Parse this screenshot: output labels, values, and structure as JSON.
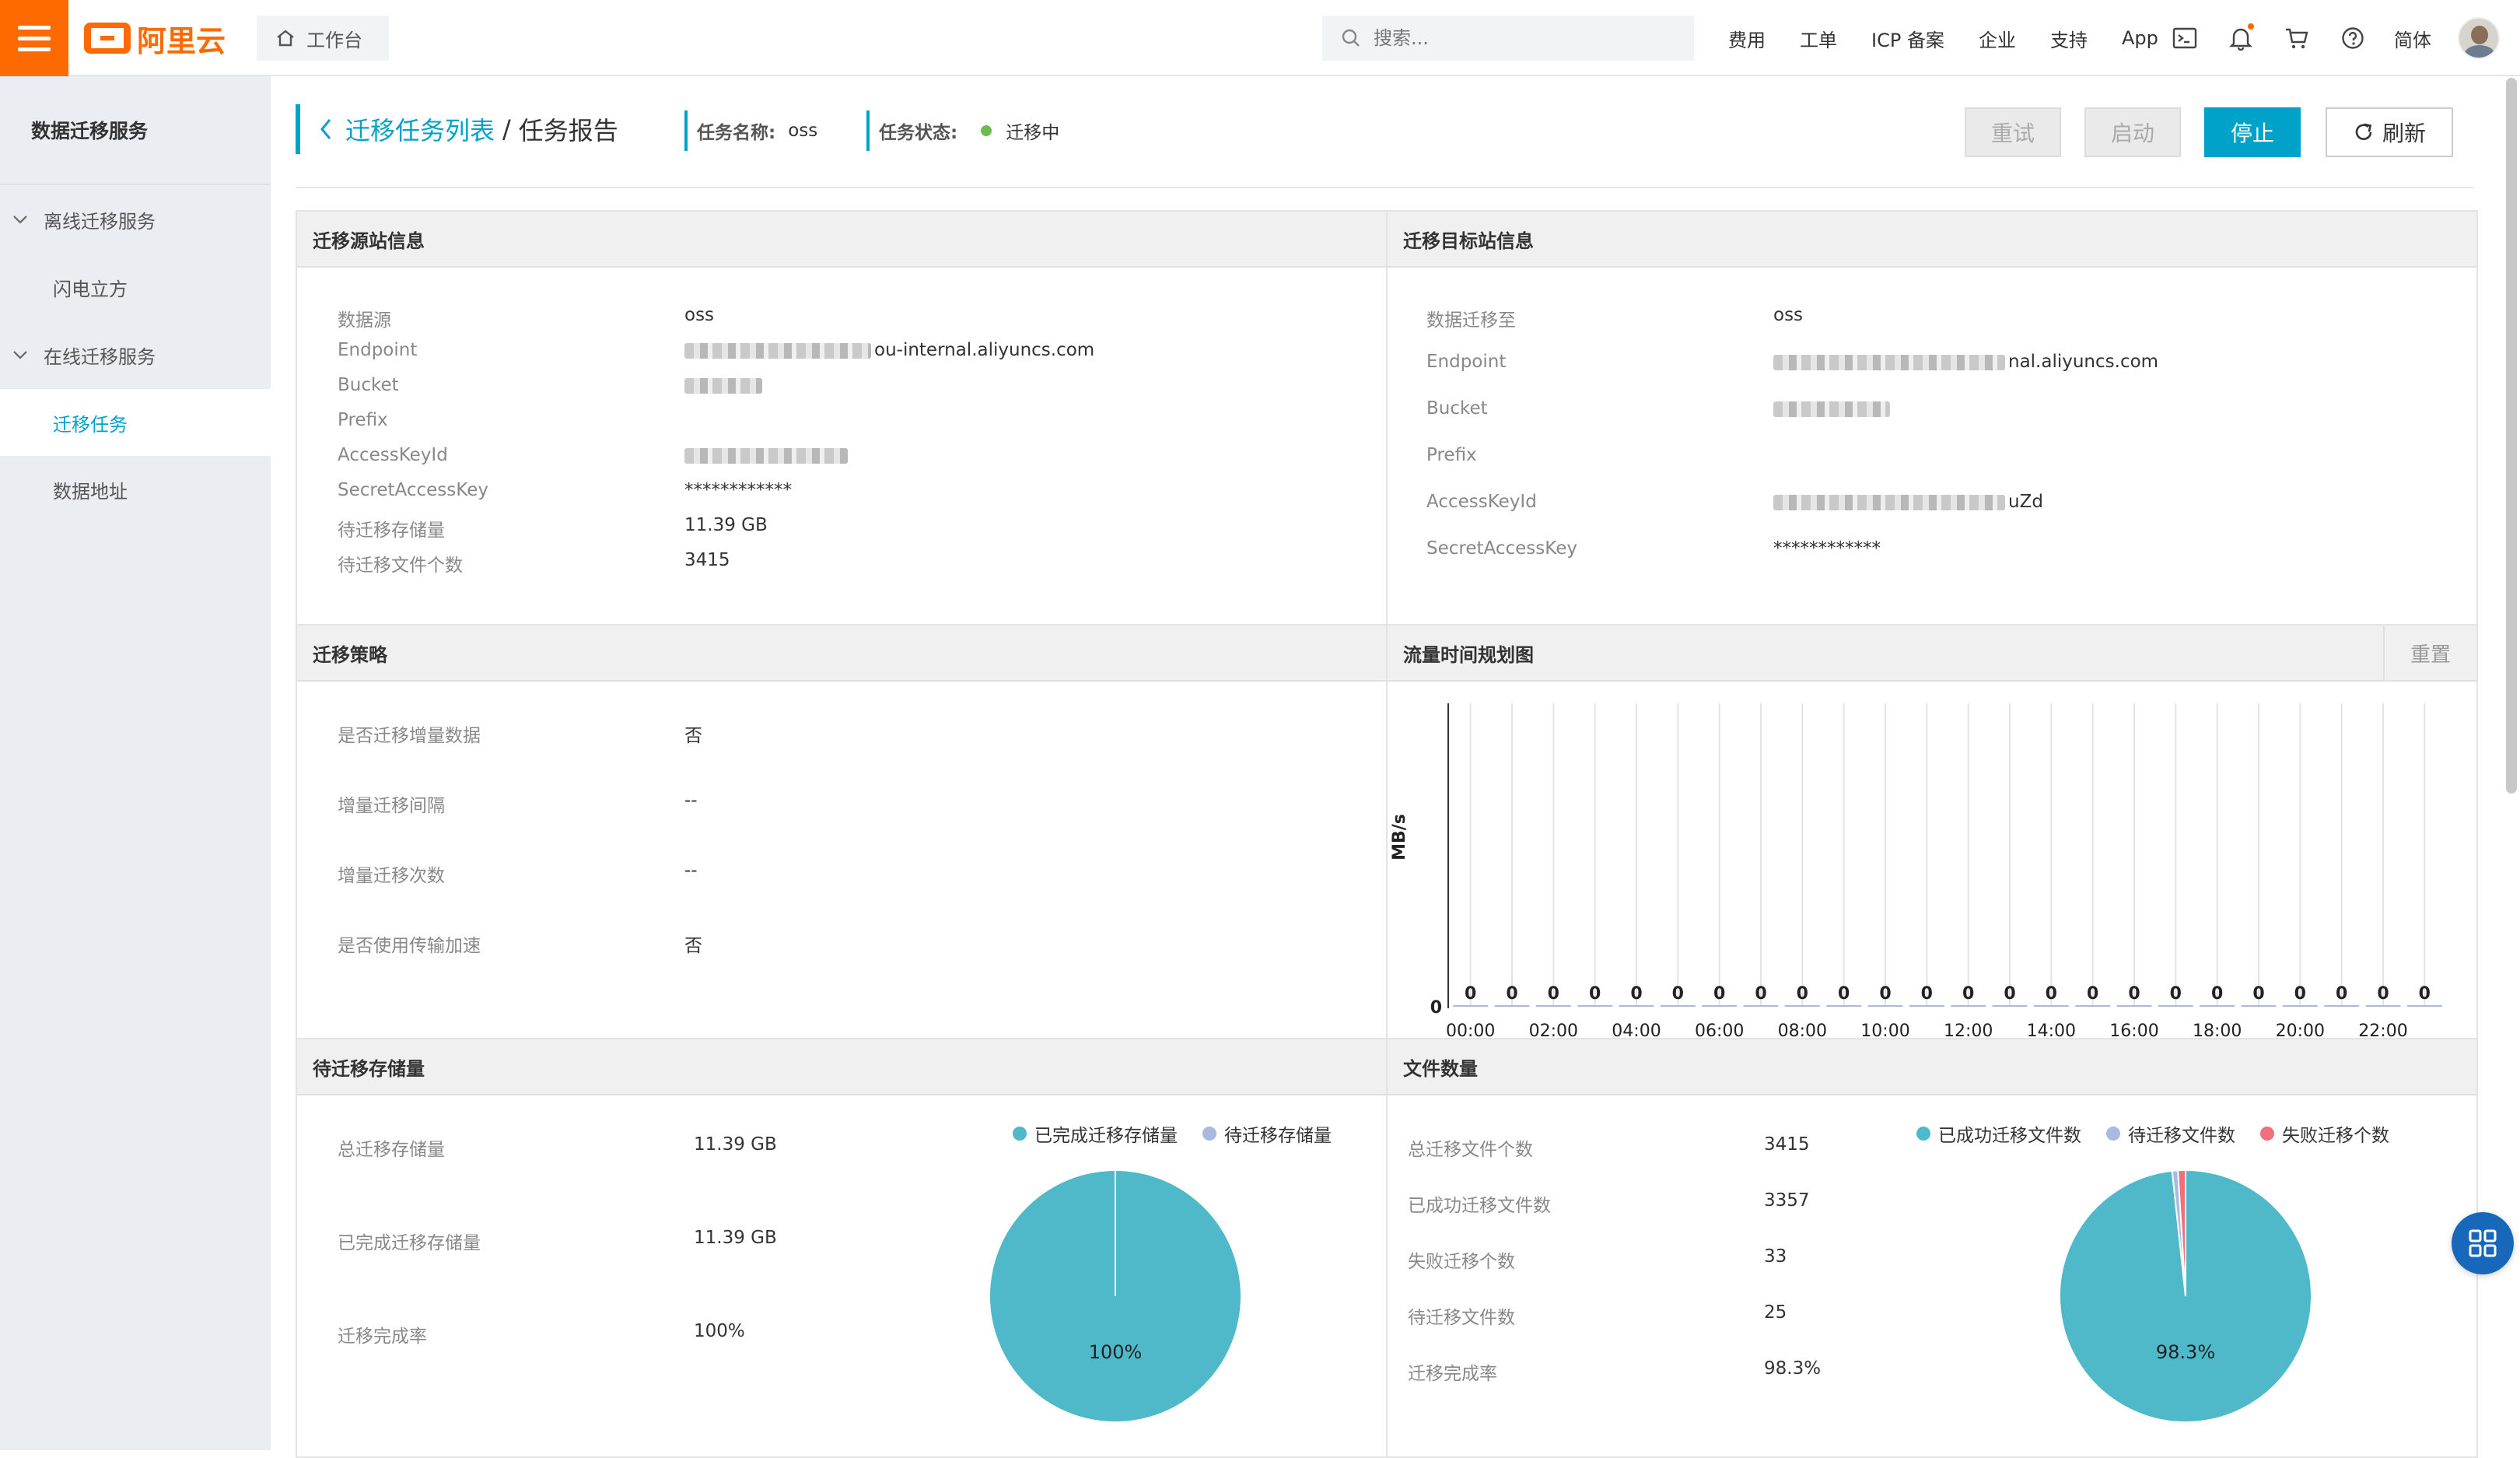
{
  "header": {
    "logo_text": "阿里云",
    "workbench": "工作台",
    "search_placeholder": "搜索...",
    "links": [
      "费用",
      "工单",
      "ICP 备案",
      "企业",
      "支持",
      "App"
    ],
    "lang": "简体",
    "accent": "#ff6a00"
  },
  "sidebar": {
    "title": "数据迁移服务",
    "groups": [
      {
        "label": "离线迁移服务",
        "items": [
          "闪电立方"
        ]
      },
      {
        "label": "在线迁移服务",
        "items": [
          "迁移任务",
          "数据地址"
        ]
      }
    ],
    "active_item": "迁移任务"
  },
  "page": {
    "breadcrumb_link": "迁移任务列表",
    "breadcrumb_sep": "/",
    "title": "任务报告",
    "task_name_label": "任务名称:",
    "task_name": "oss",
    "task_status_label": "任务状态:",
    "task_status": "迁移中",
    "status_color": "#6bbd4c",
    "buttons": {
      "retry": "重试",
      "start": "启动",
      "stop": "停止",
      "refresh": "刷新"
    },
    "primary_color": "#00a2ca"
  },
  "source": {
    "title": "迁移源站信息",
    "rows": [
      {
        "k": "数据源",
        "v": "oss"
      },
      {
        "k": "Endpoint",
        "v": "ou-internal.aliyuncs.com"
      },
      {
        "k": "Bucket",
        "v": ""
      },
      {
        "k": "Prefix",
        "v": ""
      },
      {
        "k": "AccessKeyId",
        "v": ""
      },
      {
        "k": "SecretAccessKey",
        "v": "************"
      },
      {
        "k": "待迁移存储量",
        "v": "11.39 GB"
      },
      {
        "k": "待迁移文件个数",
        "v": "3415"
      }
    ]
  },
  "target": {
    "title": "迁移目标站信息",
    "rows": [
      {
        "k": "数据迁移至",
        "v": "oss"
      },
      {
        "k": "Endpoint",
        "v": "nal.aliyuncs.com"
      },
      {
        "k": "Bucket",
        "v": ""
      },
      {
        "k": "Prefix",
        "v": ""
      },
      {
        "k": "AccessKeyId",
        "v": "uZd"
      },
      {
        "k": "SecretAccessKey",
        "v": "************"
      }
    ]
  },
  "strategy": {
    "title": "迁移策略",
    "rows": [
      {
        "k": "是否迁移增量数据",
        "v": "否"
      },
      {
        "k": "增量迁移间隔",
        "v": "--"
      },
      {
        "k": "增量迁移次数",
        "v": "--"
      },
      {
        "k": "是否使用传输加速",
        "v": "否"
      }
    ]
  },
  "traffic": {
    "title": "流量时间规划图",
    "reset": "重置"
  },
  "storage": {
    "title": "待迁移存储量",
    "rows": [
      {
        "k": "总迁移存储量",
        "v": "11.39 GB"
      },
      {
        "k": "已完成迁移存储量",
        "v": "11.39 GB"
      },
      {
        "k": "迁移完成率",
        "v": "100%"
      }
    ]
  },
  "files": {
    "title": "文件数量",
    "rows": [
      {
        "k": "总迁移文件个数",
        "v": "3415"
      },
      {
        "k": "已成功迁移文件数",
        "v": "3357"
      },
      {
        "k": "失败迁移个数",
        "v": "33"
      },
      {
        "k": "待迁移文件数",
        "v": "25"
      },
      {
        "k": "迁移完成率",
        "v": "98.3%"
      }
    ]
  },
  "chart_data": [
    {
      "type": "bar",
      "title": "流量时间规划图",
      "ylabel": "MB/s",
      "categories": [
        "00:00",
        "01:00",
        "02:00",
        "03:00",
        "04:00",
        "05:00",
        "06:00",
        "07:00",
        "08:00",
        "09:00",
        "10:00",
        "11:00",
        "12:00",
        "13:00",
        "14:00",
        "15:00",
        "16:00",
        "17:00",
        "18:00",
        "19:00",
        "20:00",
        "21:00",
        "22:00",
        "23:00"
      ],
      "tick_labels": [
        "00:00",
        "02:00",
        "04:00",
        "06:00",
        "08:00",
        "10:00",
        "12:00",
        "14:00",
        "16:00",
        "18:00",
        "20:00",
        "22:00"
      ],
      "values": [
        0,
        0,
        0,
        0,
        0,
        0,
        0,
        0,
        0,
        0,
        0,
        0,
        0,
        0,
        0,
        0,
        0,
        0,
        0,
        0,
        0,
        0,
        0,
        0
      ],
      "y_tick": "0",
      "grid": true
    },
    {
      "type": "pie",
      "title": "待迁移存储量",
      "legend": [
        "已完成迁移存储量",
        "待迁移存储量"
      ],
      "colors": [
        "#4fb8c9",
        "#a9b9e0"
      ],
      "values": [
        100,
        0
      ],
      "label": "100%",
      "legend_position": "top-right"
    },
    {
      "type": "pie",
      "title": "文件数量",
      "legend": [
        "已成功迁移文件数",
        "待迁移文件数",
        "失败迁移个数"
      ],
      "colors": [
        "#4fb8c9",
        "#a9b9e0",
        "#ef6f7a"
      ],
      "values": [
        3357,
        25,
        33
      ],
      "label": "98.3%",
      "legend_position": "top-right"
    }
  ]
}
